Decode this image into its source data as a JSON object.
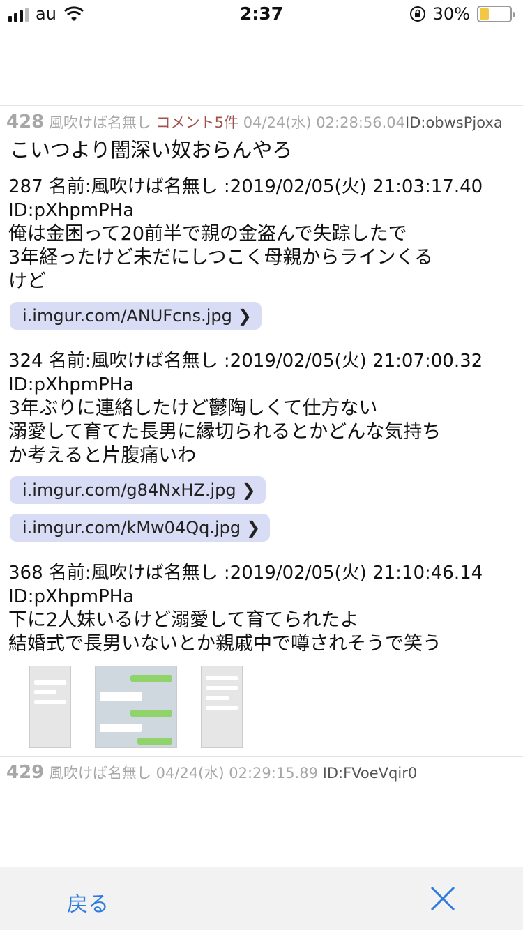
{
  "status": {
    "carrier": "au",
    "time": "2:37",
    "battery": "30%",
    "battery_level": 0.3,
    "icons": [
      "signal-icon",
      "wifi-icon",
      "orientation-lock-icon",
      "battery-icon"
    ]
  },
  "post428": {
    "number": "428",
    "name": "風吹けば名無し",
    "comment": "コメント5件",
    "date": "04/24(水) 02:28:56.04",
    "id": "ID:obwsPjoxa",
    "body": "こいつより闇深い奴おらんやろ"
  },
  "quotes": [
    {
      "header": "287 名前:風吹けば名無し :2019/02/05(火) 21:03:17.40",
      "id": "ID:pXhpmPHa",
      "lines": [
        "俺は金困って20前半で親の金盗んで失踪したで",
        "3年経ったけど未だにしつこく母親からラインくる",
        "けど"
      ],
      "links": [
        "i.imgur.com/ANUFcns.jpg"
      ]
    },
    {
      "header": "324 名前:風吹けば名無し :2019/02/05(火) 21:07:00.32",
      "id": "ID:pXhpmPHa",
      "lines": [
        "3年ぶりに連絡したけど鬱陶しくて仕方ない",
        "溺愛して育てた長男に縁切られるとかどんな気持ち",
        "か考えると片腹痛いわ"
      ],
      "links": [
        "i.imgur.com/g84NxHZ.jpg",
        "i.imgur.com/kMw04Qq.jpg"
      ]
    },
    {
      "header": "368 名前:風吹けば名無し :2019/02/05(火) 21:10:46.14",
      "id": "ID:pXhpmPHa",
      "lines": [
        "下に2人妹いるけど溺愛して育てられたよ",
        "結婚式で長男いないとか親戚中で噂されそうで笑う"
      ],
      "links": []
    }
  ],
  "post429": {
    "number": "429",
    "name": "風吹けば名無し",
    "date": "04/24(水) 02:29:15.89",
    "id": "ID:FVoeVqir0"
  },
  "nav": {
    "back_label": "戻る"
  }
}
